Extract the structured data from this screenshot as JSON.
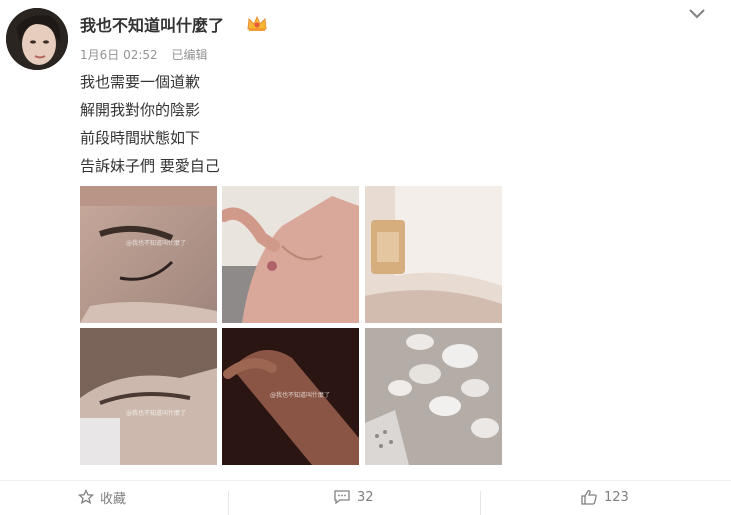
{
  "post": {
    "username": "我也不知道叫什麼了",
    "date": "1月6日 02:52",
    "edited": "已编辑",
    "lines": [
      "我也需要一個道歉",
      "解開我對你的陰影",
      "前段時間狀態如下",
      "告訴妹子們 要愛自己"
    ]
  },
  "photos": [
    {
      "watermark": "@我也不知道叫什麼了"
    },
    {
      "watermark": ""
    },
    {
      "watermark": ""
    },
    {
      "watermark": "@我也不知道叫什麼了"
    },
    {
      "watermark": "@我也不知道叫什麼了"
    },
    {
      "watermark": ""
    }
  ],
  "footer": {
    "favorite_label": "收藏",
    "comment_count": "32",
    "like_count": "123"
  },
  "icons": {
    "menu": "chevron-down-icon",
    "badge": "crown-icon"
  }
}
